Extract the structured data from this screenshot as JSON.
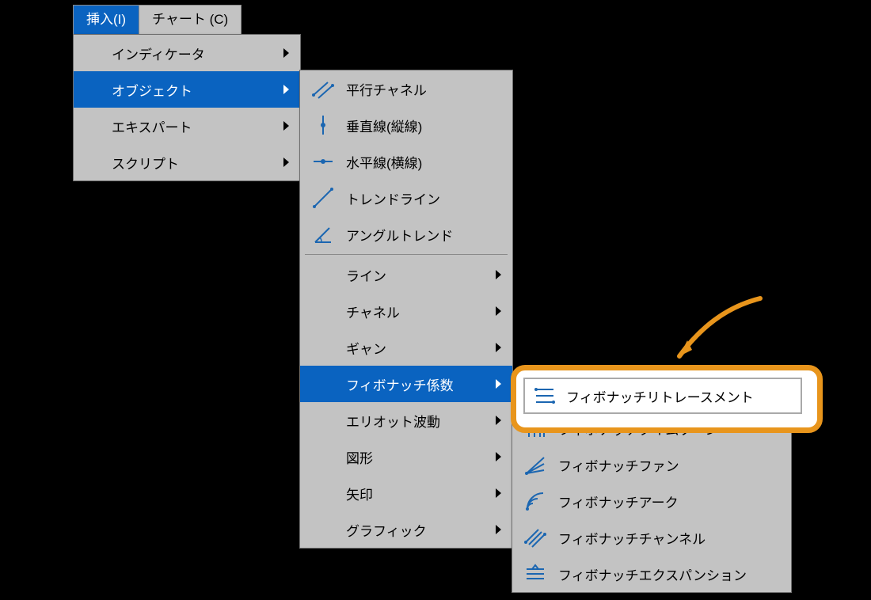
{
  "colors": {
    "accent": "#0a63c0",
    "panel": "#c3c3c3",
    "hl_ring": "#e8951c",
    "icon": "#1b66b1"
  },
  "menubar": {
    "tabs": [
      {
        "label": "挿入(I)",
        "active": true
      },
      {
        "label": "チャート (C)",
        "active": false
      }
    ]
  },
  "insert_menu": {
    "items": [
      {
        "label": "インディケータ",
        "submenu": true,
        "highlight": false
      },
      {
        "label": "オブジェクト",
        "submenu": true,
        "highlight": true
      },
      {
        "label": "エキスパート",
        "submenu": true,
        "highlight": false
      },
      {
        "label": "スクリプト",
        "submenu": true,
        "highlight": false
      }
    ]
  },
  "objects_menu": {
    "section1": [
      {
        "icon": "parallel-channel-icon",
        "label": "平行チャネル"
      },
      {
        "icon": "vertical-line-icon",
        "label": "垂直線(縦線)"
      },
      {
        "icon": "horizontal-line-icon",
        "label": "水平線(横線)"
      },
      {
        "icon": "trend-line-icon",
        "label": "トレンドライン"
      },
      {
        "icon": "angle-trend-icon",
        "label": "アングルトレンド"
      }
    ],
    "section2": [
      {
        "label": "ライン",
        "submenu": true
      },
      {
        "label": "チャネル",
        "submenu": true
      },
      {
        "label": "ギャン",
        "submenu": true
      },
      {
        "label": "フィボナッチ係数",
        "submenu": true,
        "highlight": true
      },
      {
        "label": "エリオット波動",
        "submenu": true
      },
      {
        "label": "図形",
        "submenu": true
      },
      {
        "label": "矢印",
        "submenu": true
      },
      {
        "label": "グラフィック",
        "submenu": true
      }
    ]
  },
  "fibo_menu": {
    "highlighted": {
      "icon": "fibo-retracement-icon",
      "label": "フィボナッチリトレースメント"
    },
    "items": [
      {
        "icon": "fibo-timezone-icon",
        "label": "フィボナッチタイムゾーン"
      },
      {
        "icon": "fibo-fan-icon",
        "label": "フィボナッチファン"
      },
      {
        "icon": "fibo-arc-icon",
        "label": "フィボナッチアーク"
      },
      {
        "icon": "fibo-channel-icon",
        "label": "フィボナッチチャンネル"
      },
      {
        "icon": "fibo-expansion-icon",
        "label": "フィボナッチエクスパンション"
      }
    ]
  }
}
